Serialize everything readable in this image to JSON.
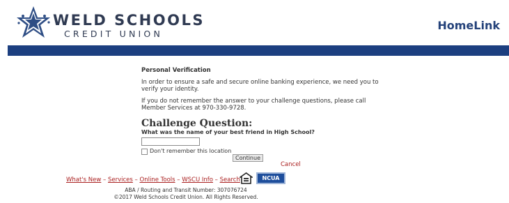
{
  "header": {
    "logo_title": "WELD SCHOOLS",
    "logo_subtitle": "CREDIT UNION",
    "app_name": "HomeLink",
    "brand_color": "#1c3f80"
  },
  "verification": {
    "heading": "Personal Verification",
    "intro": "In order to ensure a safe and secure online banking experience, we need you to verify your identity.",
    "help": "If you do not remember the answer to your challenge questions, please call Member Services at 970-330-9728.",
    "challenge_title": "Challenge Question:",
    "question": "What was the name of your best friend in High School?",
    "answer_value": "",
    "dont_remember_label": "Don't remember this location",
    "dont_remember_checked": false,
    "continue_label": "Continue",
    "cancel_label": "Cancel"
  },
  "footer": {
    "links": [
      "What's New",
      "Services",
      "Online Tools",
      "WSCU Info",
      "Search"
    ],
    "separator": " – ",
    "equal_housing_icon": "equal-housing-lender-icon",
    "ncua_label": "NCUA",
    "routing": "ABA / Routing and Transit Number: 307076724",
    "copyright": "©2017 Weld Schools Credit Union. All Rights Reserved."
  }
}
